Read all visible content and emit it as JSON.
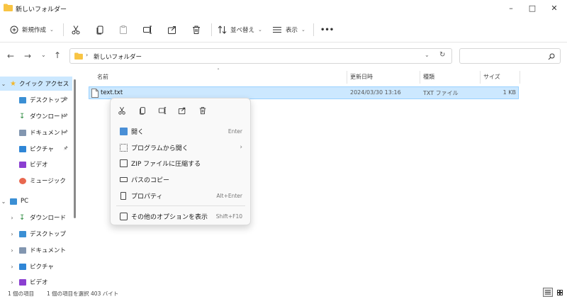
{
  "window": {
    "title": "新しいフォルダー"
  },
  "toolbar": {
    "new_label": "新規作成",
    "sort_label": "並べ替え",
    "view_label": "表示",
    "more_label": "•••"
  },
  "address": {
    "path": "新しいフォルダー",
    "separator": "›"
  },
  "search": {
    "placeholder": ""
  },
  "nav": {
    "quick_access": "クイック アクセス",
    "quick_items": [
      "デスクトップ",
      "ダウンロード",
      "ドキュメント",
      "ピクチャ",
      "ビデオ",
      "ミュージック"
    ],
    "pc": "PC",
    "pc_items": [
      "ダウンロード",
      "デスクトップ",
      "ドキュメント",
      "ピクチャ",
      "ビデオ"
    ]
  },
  "columns": {
    "name": "名前",
    "modified": "更新日時",
    "type": "種類",
    "size": "サイズ"
  },
  "file": {
    "name": "text.txt",
    "modified": "2024/03/30 13:16",
    "type": "TXT ファイル",
    "size": "1 KB"
  },
  "context_menu": {
    "items": [
      {
        "label": "開く",
        "shortcut": "Enter"
      },
      {
        "label": "プログラムから開く",
        "shortcut": "›"
      },
      {
        "label": "ZIP ファイルに圧縮する",
        "shortcut": ""
      },
      {
        "label": "パスのコピー",
        "shortcut": ""
      },
      {
        "label": "プロパティ",
        "shortcut": "Alt+Enter"
      },
      {
        "label": "その他のオプションを表示",
        "shortcut": "Shift+F10"
      }
    ]
  },
  "status": {
    "count": "1 個の項目",
    "selected": "1 個の項目を選択 403 バイト"
  },
  "colors": {
    "accent": "#0067c0",
    "selection": "#cce8ff",
    "folder": "#f8c443"
  }
}
